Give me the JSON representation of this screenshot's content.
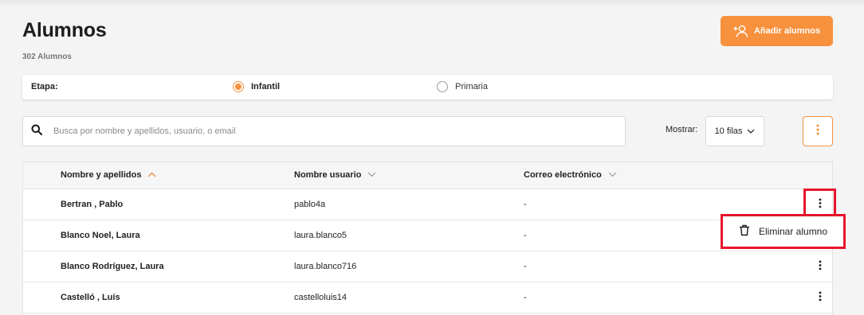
{
  "header": {
    "title": "Alumnos",
    "count_label": "302 Alumnos",
    "add_button_label": "Añadir alumnos"
  },
  "filter": {
    "label": "Etapa:",
    "options": [
      {
        "label": "Infantil",
        "selected": true
      },
      {
        "label": "Primaria",
        "selected": false
      }
    ]
  },
  "search": {
    "placeholder": "Busca por nombre y apellidos, usuario, o email",
    "value": ""
  },
  "pagination": {
    "show_label": "Mostrar:",
    "rows_value": "10 filas"
  },
  "table": {
    "columns": [
      "Nombre y apellidos",
      "Nombre usuario",
      "Correo electrónico"
    ],
    "rows": [
      {
        "name": "Bertran , Pablo",
        "user": "pablo4a",
        "email": "-"
      },
      {
        "name": "Blanco Noel, Laura",
        "user": "laura.blanco5",
        "email": "-"
      },
      {
        "name": "Blanco Rodríguez, Laura",
        "user": "laura.blanco716",
        "email": "-"
      },
      {
        "name": "Castelló , Luís",
        "user": "castelloluis14",
        "email": "-"
      }
    ]
  },
  "context_menu": {
    "delete_label": "Eliminar alumno"
  },
  "colors": {
    "accent": "#f7913d",
    "highlight": "#e8142c"
  },
  "icons": [
    "add-user-icon",
    "search-icon",
    "chevron-down-icon",
    "vertical-dots-icon",
    "sort-up-icon",
    "trash-icon"
  ]
}
